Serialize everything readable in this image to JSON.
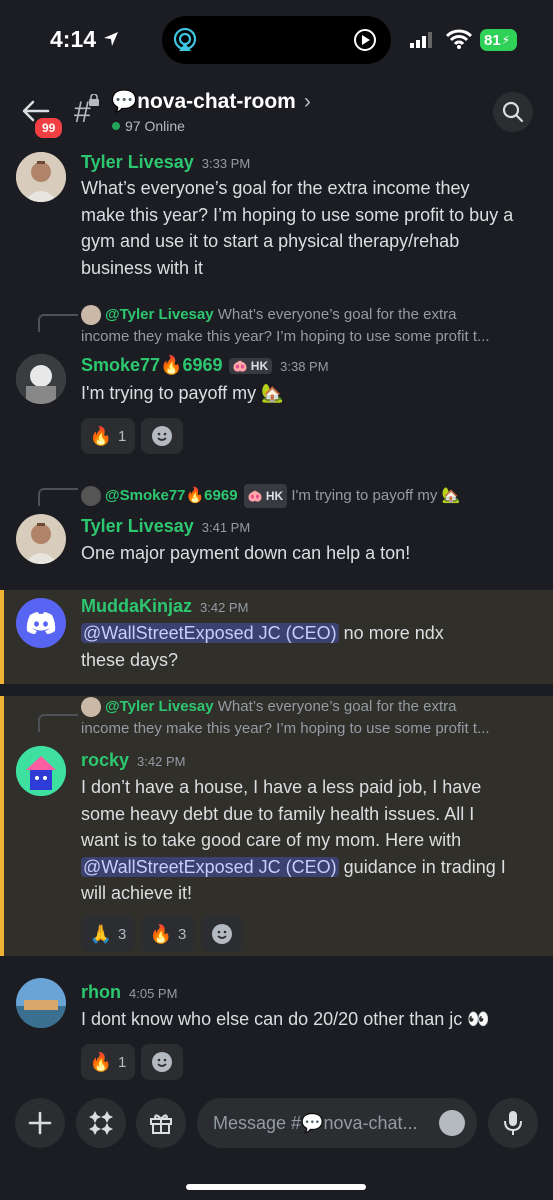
{
  "status_bar": {
    "time": "4:14",
    "battery": "81"
  },
  "header": {
    "unread_count": "99",
    "channel_name": "💬nova-chat-room",
    "online_text": "97 Online"
  },
  "messages": [
    {
      "author": "Tyler Livesay",
      "time": "3:33 PM",
      "lines": [
        "What’s everyone’s goal for the extra income they",
        "make this year? I’m hoping to use some profit to buy a",
        "gym and use it to start a physical therapy/rehab",
        "business with it"
      ]
    },
    {
      "reply_author": "@Tyler Livesay",
      "reply_text": "What’s everyone’s goal for the extra",
      "reply_text2": "income they make this year? I’m hoping to use some profit t...",
      "author": "Smoke77🔥6969",
      "tag": "HK",
      "time": "3:38 PM",
      "lines": [
        "I'm trying to payoff my 🏡"
      ],
      "reactions": [
        {
          "emoji": "🔥",
          "count": "1"
        }
      ]
    },
    {
      "reply_author": "@Smoke77🔥6969",
      "reply_tag": "HK",
      "reply_text": "I'm trying to payoff my 🏡",
      "author": "Tyler Livesay",
      "time": "3:41 PM",
      "lines": [
        "One major payment down can help a ton!"
      ]
    },
    {
      "author": "MuddaKinjaz",
      "time": "3:42 PM",
      "mention": "@WallStreetExposed JC (CEO)",
      "after_mention": " no more ndx",
      "line2": "these days?"
    },
    {
      "reply_author": "@Tyler Livesay",
      "reply_text": "What’s everyone’s goal for the extra",
      "reply_text2": "income they make this year? I’m hoping to use some profit t...",
      "author": "rocky",
      "time": "3:42 PM",
      "lines": [
        "I don’t have a house, I have a less paid job, I have",
        "some heavy debt due to family health issues. All I",
        "want is to take good care of my mom. Here with"
      ],
      "mention": "@WallStreetExposed JC (CEO)",
      "after_mention": " guidance in trading I",
      "line_last": "will achieve it!",
      "reactions": [
        {
          "emoji": "🙏",
          "count": "3"
        },
        {
          "emoji": "🔥",
          "count": "3"
        }
      ]
    },
    {
      "author": "rhon",
      "time": "4:05 PM",
      "lines": [
        "I dont know who else can do 20/20 other than jc 👀"
      ],
      "reactions": [
        {
          "emoji": "🔥",
          "count": "1"
        }
      ]
    }
  ],
  "composer": {
    "placeholder": "Message #💬nova-chat..."
  },
  "colors": {
    "username": "#2dc770",
    "mention_bg": "#3c4270",
    "highlight_border": "#f0b232",
    "online_dot": "#23a55a",
    "badge": "#f23f43"
  }
}
